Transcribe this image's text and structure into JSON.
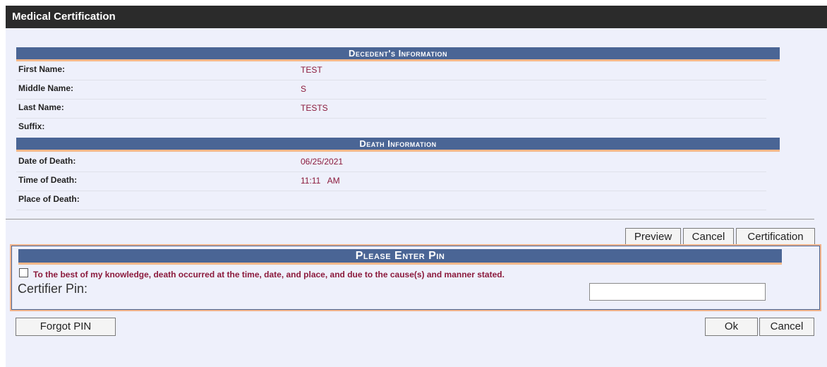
{
  "window": {
    "title": "Medical Certification"
  },
  "decedent": {
    "header": "Decedent's Information",
    "fields": [
      {
        "label": "First Name:",
        "value": "TEST"
      },
      {
        "label": "Middle Name:",
        "value": "S"
      },
      {
        "label": "Last Name:",
        "value": "TESTS"
      },
      {
        "label": "Suffix:",
        "value": ""
      }
    ]
  },
  "death": {
    "header": "Death Information",
    "fields": [
      {
        "label": "Date of Death:",
        "value": "06/25/2021"
      },
      {
        "label": "Time of Death:",
        "value": "11:11   AM"
      },
      {
        "label": "Place of Death:",
        "value": ""
      }
    ]
  },
  "actions": {
    "preview": "Preview",
    "cancel": "Cancel",
    "certification": "Certification"
  },
  "pin": {
    "header": "Please Enter Pin",
    "statement": "To the best of my knowledge, death occurred at the time, date, and place, and due to the cause(s) and manner stated.",
    "checked": false,
    "label": "Certifier Pin:",
    "value": ""
  },
  "footer": {
    "forgot_pin": "Forgot PIN",
    "ok": "Ok",
    "cancel": "Cancel"
  }
}
